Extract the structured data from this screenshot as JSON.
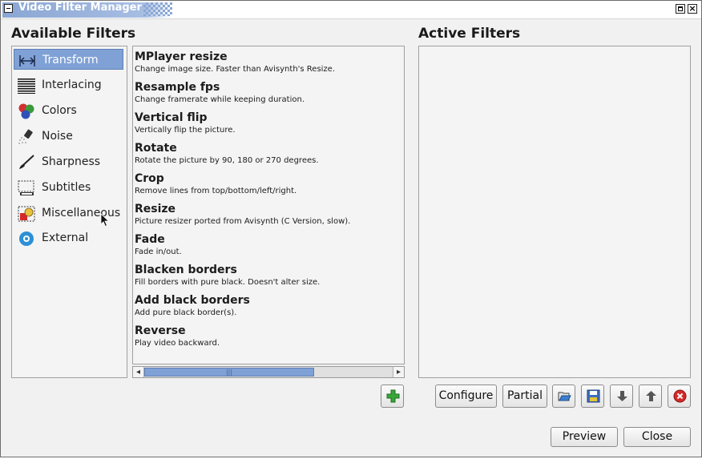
{
  "window": {
    "title": "Video Filter Manager",
    "close_glyph": "×"
  },
  "available": {
    "heading": "Available Filters",
    "categories": [
      {
        "label": "Transform",
        "icon": "transform-icon",
        "selected": true
      },
      {
        "label": "Interlacing",
        "icon": "interlacing-icon"
      },
      {
        "label": "Colors",
        "icon": "colors-icon"
      },
      {
        "label": "Noise",
        "icon": "noise-icon"
      },
      {
        "label": "Sharpness",
        "icon": "sharpness-icon"
      },
      {
        "label": "Subtitles",
        "icon": "subtitles-icon"
      },
      {
        "label": "Miscellaneous",
        "icon": "miscellaneous-icon"
      },
      {
        "label": "External",
        "icon": "external-icon"
      }
    ],
    "filters": [
      {
        "name": "MPlayer resize",
        "desc": "Change image size. Faster than Avisynth's Resize."
      },
      {
        "name": "Resample fps",
        "desc": "Change framerate while keeping duration."
      },
      {
        "name": "Vertical flip",
        "desc": "Vertically flip the picture."
      },
      {
        "name": "Rotate",
        "desc": "Rotate the picture by 90, 180 or 270 degrees."
      },
      {
        "name": "Crop",
        "desc": "Remove lines from top/bottom/left/right."
      },
      {
        "name": "Resize",
        "desc": "Picture resizer ported from Avisynth (C Version, slow)."
      },
      {
        "name": "Fade",
        "desc": "Fade in/out."
      },
      {
        "name": "Blacken borders",
        "desc": "Fill borders with pure black. Doesn't alter size."
      },
      {
        "name": "Add black borders",
        "desc": "Add pure black border(s)."
      },
      {
        "name": "Reverse",
        "desc": "Play video backward."
      }
    ],
    "scroll_grip": "|||"
  },
  "active": {
    "heading": "Active Filters"
  },
  "buttons": {
    "configure": "Configure",
    "partial": "Partial",
    "preview": "Preview",
    "close": "Close"
  },
  "colors": {
    "selection": "#7fa1d6",
    "add": "#3aa63a",
    "remove": "#d42a2a"
  }
}
